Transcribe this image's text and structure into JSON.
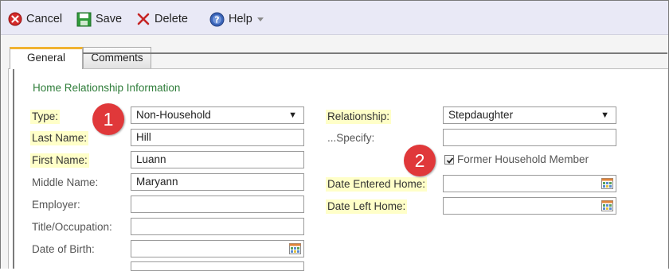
{
  "toolbar": {
    "cancel": "Cancel",
    "save": "Save",
    "delete": "Delete",
    "help": "Help"
  },
  "tabs": [
    {
      "label": "General",
      "active": true
    },
    {
      "label": "Comments",
      "active": false
    }
  ],
  "section": {
    "legend": "Home Relationship Information"
  },
  "left_fields": {
    "type": {
      "label": "Type:",
      "value": "Non-Household"
    },
    "last_name": {
      "label": "Last Name:",
      "value": "Hill"
    },
    "first_name": {
      "label": "First Name:",
      "value": "Luann"
    },
    "middle_name": {
      "label": "Middle Name:",
      "value": "Maryann"
    },
    "employer": {
      "label": "Employer:",
      "value": ""
    },
    "title_occupation": {
      "label": "Title/Occupation:",
      "value": ""
    },
    "date_of_birth": {
      "label": "Date of Birth:",
      "value": ""
    }
  },
  "right_fields": {
    "relationship": {
      "label": "Relationship:",
      "value": "Stepdaughter"
    },
    "specify": {
      "label": "...Specify:",
      "value": ""
    },
    "former_household": {
      "label": "Former Household Member",
      "checked": true
    },
    "date_entered_home": {
      "label": "Date Entered Home:",
      "value": ""
    },
    "date_left_home": {
      "label": "Date Left Home:",
      "value": ""
    }
  },
  "callouts": [
    "1",
    "2"
  ],
  "colors": {
    "toolbar_bg": "#e9e9f6",
    "required_highlight": "#ffffc8",
    "legend_text": "#2f7d3a",
    "callout_red": "#e0383a",
    "active_tab_accent": "#f0b330"
  }
}
